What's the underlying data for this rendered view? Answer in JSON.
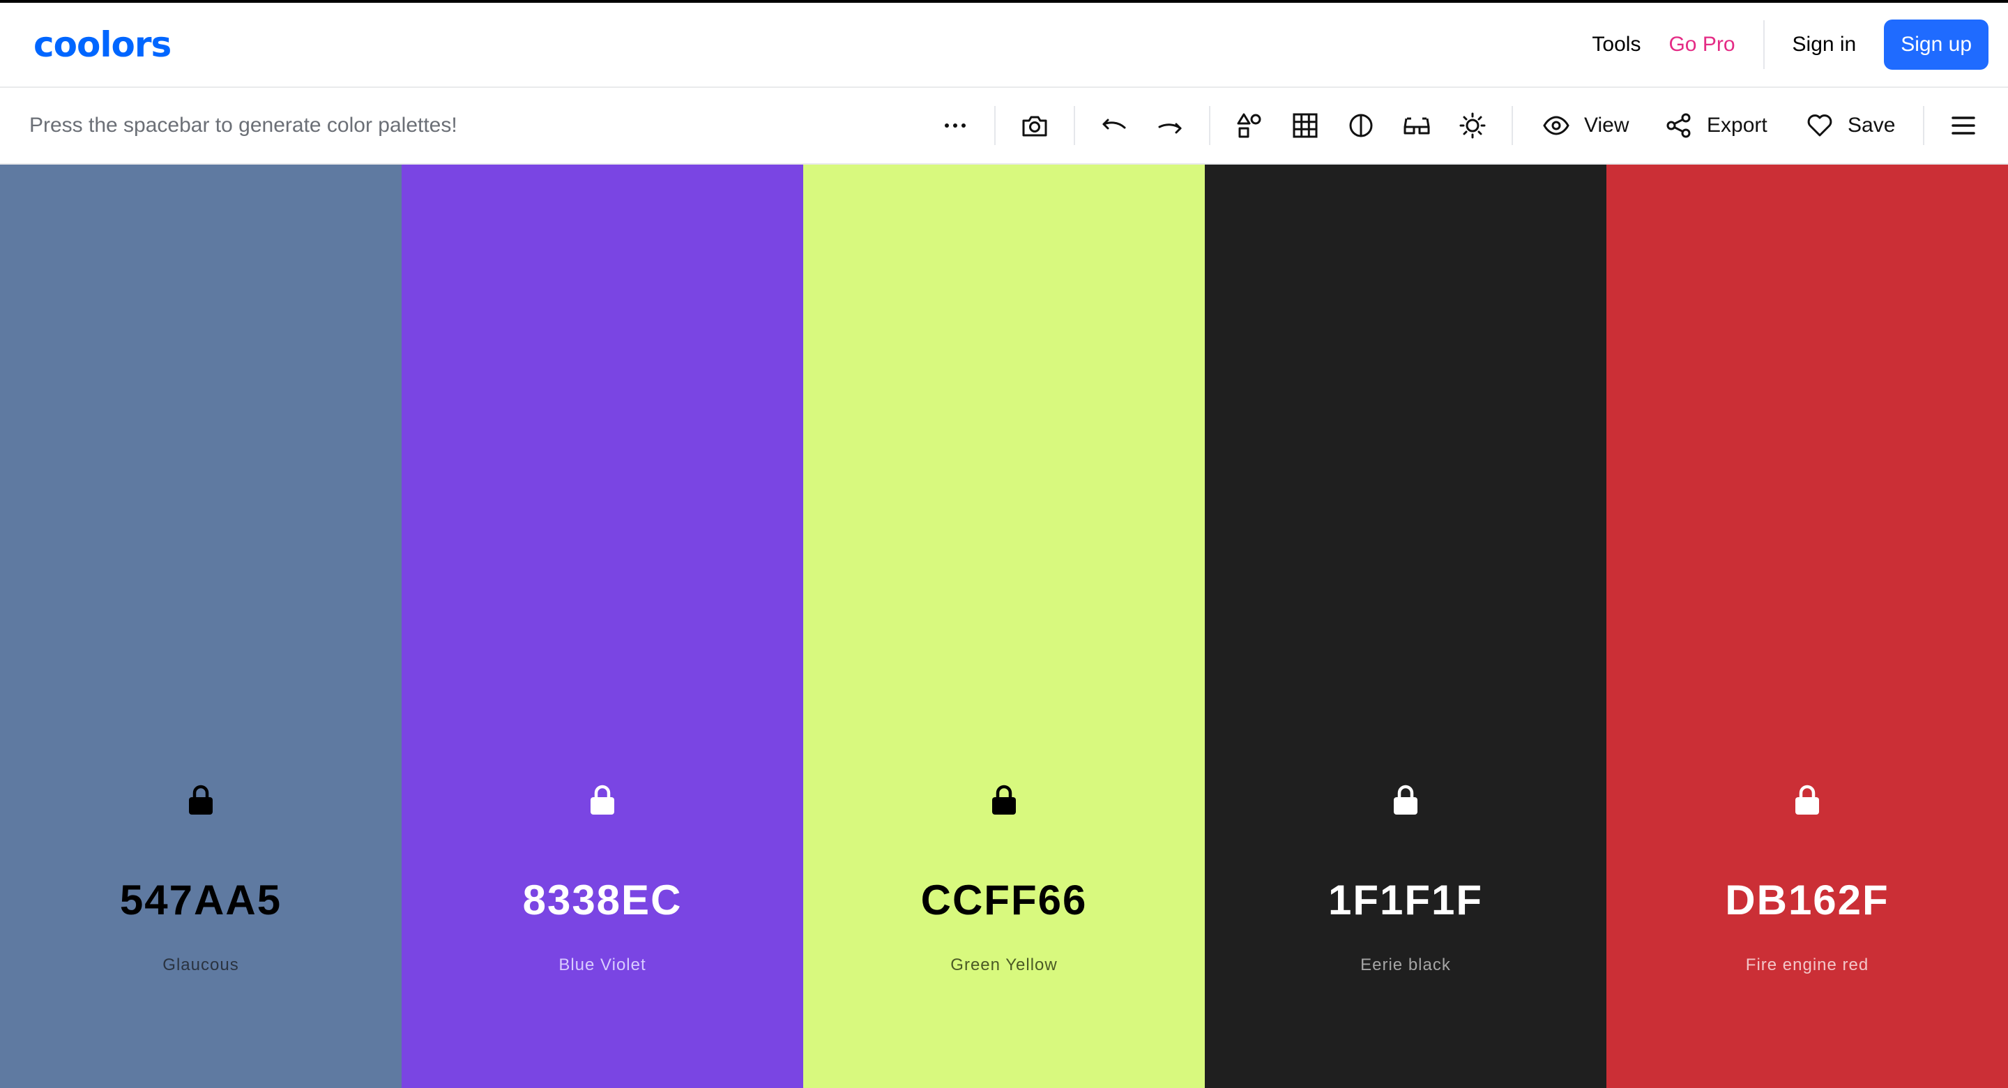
{
  "nav": {
    "logo": "coolors",
    "tools": "Tools",
    "go_pro": "Go Pro",
    "sign_in": "Sign in",
    "sign_up": "Sign up"
  },
  "toolbar": {
    "hint": "Press the spacebar to generate color palettes!",
    "icons": [
      "more-icon",
      "camera-icon",
      "undo-icon",
      "redo-icon",
      "shapes-icon",
      "grid-icon",
      "contrast-icon",
      "glasses-icon",
      "sun-icon",
      "menu-icon"
    ],
    "view": "View",
    "export": "Export",
    "save": "Save"
  },
  "palette": [
    {
      "hex": "547AA5",
      "name": "Glaucous",
      "bg": "#5f7aa1",
      "fg": "#000000",
      "name_color": "#2a3340"
    },
    {
      "hex": "8338EC",
      "name": "Blue Violet",
      "bg": "#7a45e3",
      "fg": "#ffffff",
      "name_color": "#d9ccff"
    },
    {
      "hex": "CCFF66",
      "name": "Green Yellow",
      "bg": "#d8f97e",
      "fg": "#000000",
      "name_color": "#4a5a25"
    },
    {
      "hex": "1F1F1F",
      "name": "Eerie black",
      "bg": "#1f1f1f",
      "fg": "#ffffff",
      "name_color": "#a5a5a5"
    },
    {
      "hex": "DB162F",
      "name": "Fire engine red",
      "bg": "#cb2f36",
      "fg": "#ffffff",
      "name_color": "#f3c6c8"
    }
  ]
}
